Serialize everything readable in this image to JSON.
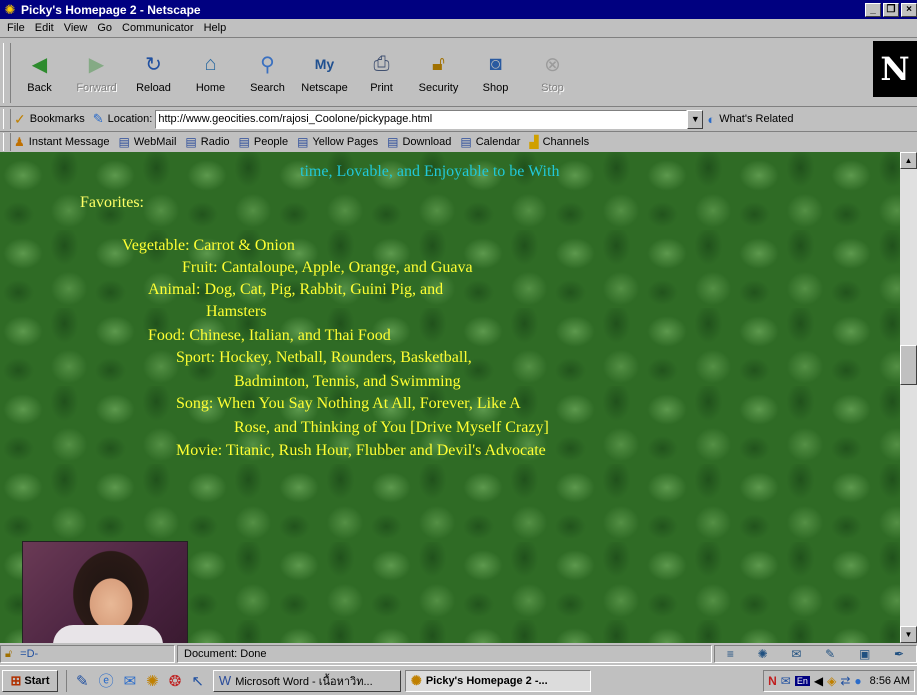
{
  "window": {
    "title": "Picky's Homepage 2 - Netscape",
    "controls": [
      "_",
      "❐",
      "×"
    ]
  },
  "menu": [
    "File",
    "Edit",
    "View",
    "Go",
    "Communicator",
    "Help"
  ],
  "nav_buttons": [
    {
      "label": "Back",
      "icon": "back-arrow-icon",
      "enabled": true
    },
    {
      "label": "Forward",
      "icon": "forward-arrow-icon",
      "enabled": false
    },
    {
      "label": "Reload",
      "icon": "reload-icon",
      "enabled": true
    },
    {
      "label": "Home",
      "icon": "home-icon",
      "enabled": true
    },
    {
      "label": "Search",
      "icon": "search-icon",
      "enabled": true
    },
    {
      "label": "Netscape",
      "icon": "netscape-icon",
      "enabled": true
    },
    {
      "label": "Print",
      "icon": "print-icon",
      "enabled": true
    },
    {
      "label": "Security",
      "icon": "security-lock-icon",
      "enabled": true
    },
    {
      "label": "Shop",
      "icon": "shop-icon",
      "enabled": true
    },
    {
      "label": "Stop",
      "icon": "stop-icon",
      "enabled": false
    }
  ],
  "location": {
    "bookmarks_label": "Bookmarks",
    "location_label": "Location:",
    "url": "http://www.geocities.com/rajosi_Coolone/pickypage.html",
    "related_label": "What's Related"
  },
  "personal_toolbar": [
    "Instant Message",
    "WebMail",
    "Radio",
    "People",
    "Yellow Pages",
    "Download",
    "Calendar",
    "Channels"
  ],
  "content": {
    "clipped_line": "time, Lovable, and Enjoyable to be With",
    "favorites_heading": "Favorites:",
    "favorites": [
      "Vegetable: Carrot & Onion",
      "Fruit: Cantaloupe, Apple, Orange, and Guava",
      "Animal: Dog, Cat, Pig, Rabbit, Guini Pig, and",
      "Hamsters",
      "Food: Chinese, Italian, and Thai Food",
      "Sport: Hockey, Netball, Rounders, Basketball,",
      "Badminton, Tennis, and Swimming",
      "Song: When You Say Nothing At All, Forever, Like A",
      "Rose, and Thinking of You [Drive Myself Crazy]",
      "Movie: Titanic, Rush Hour, Flubber and Devil's Advocate"
    ]
  },
  "status": {
    "text": "Document: Done"
  },
  "taskbar": {
    "start_label": "Start",
    "tasks": [
      {
        "label": "Microsoft Word - เนื้อหาวิท...",
        "active": false
      },
      {
        "label": "Picky's Homepage 2 -...",
        "active": true
      }
    ],
    "tray_lang": "En",
    "time": "8:56 AM"
  },
  "colors": {
    "titlebar": "#000080",
    "page_bg": "#2f6b25",
    "favorites_text": "#ffff33",
    "cyan_text": "#22c8d8"
  }
}
